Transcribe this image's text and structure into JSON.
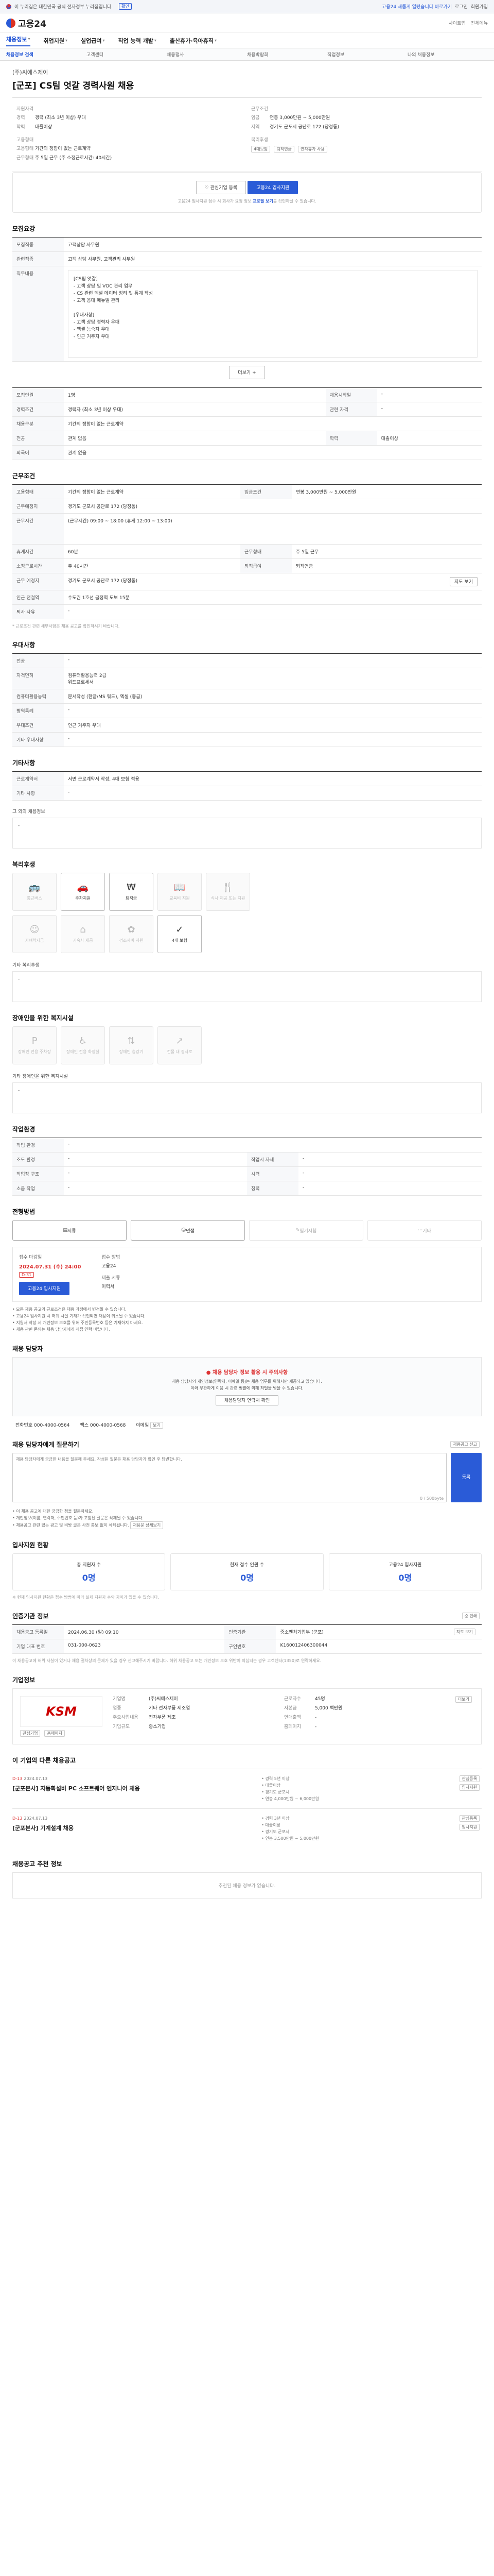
{
  "topbar": {
    "notice": "이 누리집은 대한민국 공식 전자정부 누리집입니다.",
    "toggle": "확인",
    "announcement": "고용24 새롭게 열렸습니다 바로가기",
    "links": [
      "로그인",
      "회원가입"
    ]
  },
  "brand": {
    "name": "고용24"
  },
  "header": {
    "actions": [
      "사이트맵",
      "전체메뉴"
    ]
  },
  "gnb": {
    "items": [
      "채용정보",
      "취업지원",
      "실업급여",
      "직업 능력 개발",
      "출산휴가·육아휴직"
    ]
  },
  "subnav": {
    "items": [
      "채용정보 검색",
      "고객센터",
      "채용행사",
      "채용박람회",
      "직업정보",
      "나의 채용정보"
    ]
  },
  "job": {
    "company": "(주)씨에스제이",
    "title": "[군포] CS팀 엇갈 경력사원 채용",
    "apply_label": "지원자격",
    "recruit_label": "근무조건"
  },
  "summary": {
    "left": {
      "section": "지원자격",
      "rows": [
        {
          "k": "경력",
          "v": "경력 (최소 3년 이상) 우대"
        },
        {
          "k": "학력",
          "v": "대졸이상"
        }
      ],
      "section2": "고용형태",
      "rows2": [
        {
          "k": "고용형태",
          "v": "기간의 정함이 없는 근로계약"
        },
        {
          "k": "근무형태",
          "v": "주 5일 근무 (주 소정근로시간: 40시간)"
        }
      ]
    },
    "right": {
      "section": "근무조건",
      "rows": [
        {
          "k": "임금",
          "v": "연봉 3,000만원 ~ 5,000만원"
        },
        {
          "k": "지역",
          "v": "경기도 군포시 공단로 172 (당정동)"
        }
      ],
      "section2": "복리후생",
      "chips": [
        "4대보험",
        "퇴직연금",
        "연차휴가 사용"
      ]
    }
  },
  "actions": {
    "bookmark": "관심기업 등록",
    "apply": "고용24 입사지원",
    "note_pre": "고용24 입사지원 접수 시 회사가 요청 정보",
    "note_link": "프로필 보기",
    "note_post": "를 확인하실 수 있습니다."
  },
  "detail": {
    "title": "모집요강",
    "rows": [
      {
        "th": "모집직종",
        "td": "고객상담 사무원"
      },
      {
        "th": "관련직종",
        "td": "고객 상담 사무원, 고객관리 사무원"
      },
      {
        "th": "직무내용",
        "td": "[CS팀 엇갈]\n- 고객 상담 및 VOC 관리 업무\n- CS 관련 엑셀 데이터 정리 및 통계 작성\n- 고객 응대 매뉴얼 관리\n\n[우대사항]\n- 고객 상담 경력자 우대\n- 엑셀 능숙자 우대\n- 인근 거주자 우대"
      }
    ],
    "more": "더보기 +"
  },
  "req_table": {
    "rows": [
      {
        "th": "모집인원",
        "td": "1명",
        "th2": "채용시작일",
        "td2": "-"
      },
      {
        "th": "경력조건",
        "td": "경력자 (최소 3년 이상 우대)",
        "th2": "관련 자격",
        "td2": "-"
      },
      {
        "th": "채용구분",
        "td": "기간의 정함이 없는 근로계약",
        "th2": "",
        "td2": ""
      },
      {
        "th": "전공",
        "td": "관계 없음",
        "th2": "학력",
        "td2": "대졸이상"
      },
      {
        "th": "외국어",
        "td": "관계 없음",
        "th2": "",
        "td2": ""
      }
    ]
  },
  "work": {
    "title": "근무조건",
    "rows": [
      {
        "th": "고용형태",
        "td": "기간의 정함이 없는 근로계약",
        "th2": "임금조건",
        "td2": "연봉 3,000만원 ~ 5,000만원"
      },
      {
        "th": "근무예정지",
        "td": "경기도 군포시 공단로 172 (당정동)",
        "th2": "",
        "td2": ""
      },
      {
        "th": "근무시간",
        "td": "(근무시간) 09:00 ~ 18:00 (휴게 12:00 ~ 13:00)",
        "th2": "",
        "td2": ""
      },
      {
        "th": "휴게시간",
        "td": "60분",
        "th2": "근무형태",
        "td2": "주 5일 근무"
      },
      {
        "th": "소정근로시간",
        "td": "주 40시간",
        "th2": "퇴직급여",
        "td2": "퇴직연금"
      },
      {
        "th": "근무 예정지",
        "td": "경기도 군포시 공단로 172 (당정동)",
        "th2": "",
        "td2": ""
      },
      {
        "th": "인근 전철역",
        "td": "수도권 1호선 금정역 도보 15분",
        "th2": "",
        "td2": ""
      },
      {
        "th": "퇴사 사유",
        "td": "-",
        "th2": "",
        "td2": ""
      }
    ],
    "map_button": "지도 보기",
    "note": "* 근로조건 관련 세부사항은 채용 공고를 확인하시기 바랍니다."
  },
  "prefer": {
    "title": "우대사항",
    "rows": [
      {
        "th": "전공",
        "td": "-"
      },
      {
        "th": "자격면허",
        "td": "컴퓨터활용능력 2급\n워드프로세서"
      },
      {
        "th": "컴퓨터활용능력",
        "td": "문서작성 (한글/MS 워드), 엑셀 (중급)"
      },
      {
        "th": "병역특례",
        "td": "-"
      },
      {
        "th": "우대조건",
        "td": "인근 거주자 우대"
      },
      {
        "th": "기타 우대사항",
        "td": "-"
      }
    ]
  },
  "etc": {
    "title": "기타사항",
    "rows": [
      {
        "th": "근로계약서",
        "td": "서면 근로계약서 작성, 4대 보험 적용"
      },
      {
        "th": "기타 사항",
        "td": "-"
      }
    ],
    "sub": "그 외의 채용정보",
    "sub_value": "-"
  },
  "welfare": {
    "title": "복리후생",
    "items": [
      {
        "label": "통근버스",
        "icon": "bus-icon",
        "glyph": "🚌",
        "on": false
      },
      {
        "label": "주차지원",
        "icon": "car-icon",
        "glyph": "🚗",
        "on": true
      },
      {
        "label": "퇴직금",
        "icon": "money-icon",
        "glyph": "₩",
        "on": true
      },
      {
        "label": "교육비 지원",
        "icon": "book-icon",
        "glyph": "📖",
        "on": false
      },
      {
        "label": "식사 제공 또는 지원",
        "icon": "meal-icon",
        "glyph": "🍴",
        "on": false
      },
      {
        "label": "자녀학자금",
        "icon": "child-icon",
        "glyph": "☺",
        "on": false
      },
      {
        "label": "기숙사 제공",
        "icon": "home-icon",
        "glyph": "⌂",
        "on": false
      },
      {
        "label": "경조사비 지원",
        "icon": "gift-icon",
        "glyph": "✿",
        "on": false
      },
      {
        "label": "4대 보험",
        "icon": "shield-icon",
        "glyph": "✓",
        "on": true
      }
    ],
    "other_title": "기타 복리후생",
    "other_value": "-"
  },
  "disability": {
    "title": "장애인을 위한 복지시설",
    "items": [
      {
        "label": "장애인 전용 주차장",
        "glyph": "P"
      },
      {
        "label": "장애인 전용 화장실",
        "glyph": "♿"
      },
      {
        "label": "장애인 승강기",
        "glyph": "⇅"
      },
      {
        "label": "건물 내 경사로",
        "glyph": "↗"
      }
    ],
    "other_title": "기타 장애인을 위한 복지시설",
    "other_value": "-"
  },
  "env": {
    "title": "작업환경",
    "rows": [
      {
        "th": "작업 환경",
        "td": "-",
        "th2": "",
        "td2": ""
      },
      {
        "th": "조도 환경",
        "td": "-",
        "th2": "작업시 자세",
        "td2": "-"
      },
      {
        "th": "작업장 구조",
        "td": "-",
        "th2": "시력",
        "td2": "-"
      },
      {
        "th": "소음 작업",
        "td": "-",
        "th2": "청력",
        "td2": "-"
      }
    ]
  },
  "process": {
    "title": "전형방법",
    "steps": [
      {
        "label": "서류",
        "on": true
      },
      {
        "label": "면접",
        "on": true
      },
      {
        "label": "필기시험",
        "on": false
      },
      {
        "label": "기타",
        "on": false
      }
    ],
    "deadline_label": "접수 마감일",
    "deadline": "2024.07.31 (수) 24:00",
    "dday": "D-31",
    "method_label": "접수 방법",
    "method": "고용24",
    "docs_label": "제출 서류",
    "docs": "이력서",
    "apply_button": "고용24 입사지원",
    "bullets": [
      "모든 채용 공고의 근로조건은 채용 과정에서 변경될 수 있습니다.",
      "고용24 입사지원 시 허위 사실 기재가 확인되면 채용이 취소될 수 있습니다.",
      "지원서 작성 시 개인정보 보호를 위해 주민등록번호 등은 기재하지 마세요.",
      "채용 관련 문의는 채용 담당자에게 직접 연락 바랍니다."
    ]
  },
  "contact": {
    "title": "채용 담당자",
    "warn": "채용 담당자 정보 활용 시 주의사항",
    "warn_text1": "채용 담당자의 개인정보(연락처, 이메일 등)는 채용 업무를 위해서만 제공되고 있습니다.",
    "warn_text2": "이와 무관하게 이용 시 관련 법률에 의해 처벌을 받을 수 있습니다.",
    "check_button": "채용담당자 연락처 확인",
    "phone_label": "전화번호",
    "phone": "000-4000-0564",
    "fax_label": "팩스",
    "fax": "000-4000-0568",
    "email_label": "이메일",
    "email_button": "보기"
  },
  "qna": {
    "title": "채용 담당자에게 질문하기",
    "report": "채용공고 신고",
    "placeholder": "채용 담당자에게 궁금한 내용을 질문해 주세요. 작성된 질문은 채용 담당자가 확인 후 답변합니다.",
    "counter": "0 / 500byte",
    "submit": "등록",
    "notes": [
      "이 채용 공고에 대한 궁금한 점을 질문하세요.",
      "개인정보(이름, 연락처, 주민번호 등)가 포함된 질문은 삭제될 수 있습니다.",
      "채용공고 관련 없는 광고 및 비방 글은 사전 통보 없이 삭제됩니다."
    ],
    "more": "채용문 상세보기"
  },
  "stats": {
    "title": "입사지원 현황",
    "cards": [
      {
        "label": "총 지원자 수",
        "value": "0명"
      },
      {
        "label": "현재 접수 인원 수",
        "value": "0명"
      },
      {
        "label": "고용24 입사지원",
        "value": "0명"
      }
    ],
    "note": "※ 현재 입사지원 현황은 접수 방법에 따라 실제 지원자 수와 차이가 있을 수 있습니다."
  },
  "regist": {
    "title": "인증기관 정보",
    "print": "인쇄",
    "rows": [
      {
        "th": "채용공고 등록일",
        "td": "2024.06.30 (일) 09:10",
        "th2": "인증기관",
        "td2": "중소벤처기업부 (군포)"
      },
      {
        "th": "기업 대표 번호",
        "td": "031-000-0623",
        "th2": "구인번호",
        "td2": "K160012406300044"
      }
    ],
    "map_button": "지도 보기",
    "notice": "이 채용공고에 허위 사실이 있거나 채용 절차상의 문제가 있을 경우 신고해주시기 바랍니다. 허위 채용공고 또는 개인정보 보호 위반이 의심되는 경우 고객센터(1350)로 연락하세요."
  },
  "companyinfo": {
    "title": "기업정보",
    "logo_text": "KSM",
    "btn_favorite": "관심기업",
    "btn_homepage": "홈페이지",
    "rows": [
      {
        "k": "기업명",
        "v": "(주)씨에스제이"
      },
      {
        "k": "업종",
        "v": "기타 전자부품 제조업"
      },
      {
        "k": "주요사업내용",
        "v": "전자부품 제조"
      },
      {
        "k": "기업규모",
        "v": "중소기업"
      }
    ],
    "rows2": [
      {
        "k": "근로자수",
        "v": "45명"
      },
      {
        "k": "자본금",
        "v": "5,000 백만원"
      },
      {
        "k": "연매출액",
        "v": "-"
      },
      {
        "k": "홈페이지",
        "v": "-"
      }
    ],
    "more_button": "더보기"
  },
  "more_jobs": {
    "title": "이 기업의 다른 채용공고",
    "items": [
      {
        "dday": "D-13",
        "date": "2024.07.13",
        "title": "[군포본사] 자동화설비 PC 소프트웨어 엔지니어 채용",
        "meta": [
          "경력 5년 이상",
          "대졸이상",
          "경기도 군포시",
          "연봉 4,000만원 ~ 6,000만원"
        ],
        "btn": "관심등록",
        "btn2": "입사지원"
      },
      {
        "dday": "D-13",
        "date": "2024.07.13",
        "title": "[군포본사] 기계설계 채용",
        "meta": [
          "경력 3년 이상",
          "대졸이상",
          "경기도 군포시",
          "연봉 3,500만원 ~ 5,000만원"
        ],
        "btn": "관심등록",
        "btn2": "입사지원"
      }
    ]
  },
  "similar": {
    "title": "채용공고 추천 정보",
    "empty": "추천된 채용 정보가 없습니다."
  },
  "colors": {
    "accent": "#2a5bd7",
    "danger": "#d33"
  }
}
